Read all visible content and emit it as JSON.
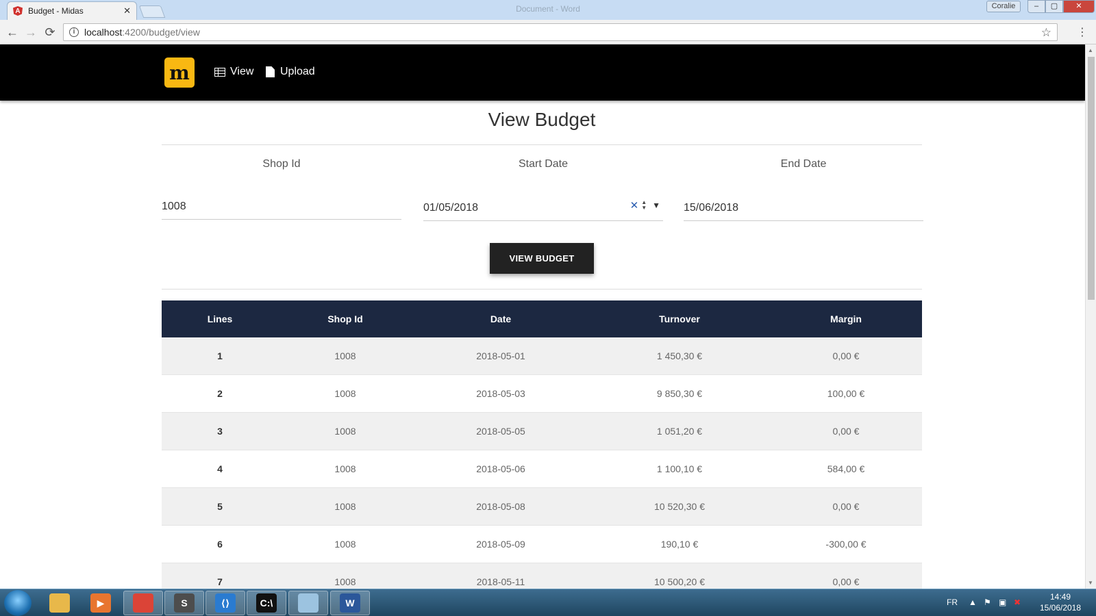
{
  "browser": {
    "tab_title": "Budget - Midas",
    "tab_close": "✕",
    "window_title": "Document - Word",
    "user_badge": "Coralie",
    "url_host": "localhost",
    "url_path": ":4200/budget/view",
    "controls": {
      "minimize": "–",
      "maximize": "▢",
      "close": "✕"
    },
    "icons": {
      "back": "←",
      "forward": "→",
      "reload": "⟳",
      "info": "i",
      "star": "☆",
      "menu": "⋮"
    }
  },
  "navbar": {
    "logo_text": "m",
    "links": [
      {
        "label": "View",
        "icon": "table-icon"
      },
      {
        "label": "Upload",
        "icon": "file-icon"
      }
    ]
  },
  "page": {
    "title": "View Budget",
    "fields": {
      "shop_id": {
        "label": "Shop Id",
        "value": "1008"
      },
      "start_date": {
        "label": "Start Date",
        "value": "01/05/2018"
      },
      "end_date": {
        "label": "End Date",
        "value": "15/06/2018"
      }
    },
    "date_controls": {
      "clear": "✕",
      "up": "▲",
      "down": "▼",
      "dropdown": "▼"
    },
    "view_button": "VIEW BUDGET"
  },
  "table": {
    "headers": [
      "Lines",
      "Shop Id",
      "Date",
      "Turnover",
      "Margin"
    ],
    "rows": [
      [
        "1",
        "1008",
        "2018-05-01",
        "1 450,30 €",
        "0,00 €"
      ],
      [
        "2",
        "1008",
        "2018-05-03",
        "9 850,30 €",
        "100,00 €"
      ],
      [
        "3",
        "1008",
        "2018-05-05",
        "1 051,20 €",
        "0,00 €"
      ],
      [
        "4",
        "1008",
        "2018-05-06",
        "1 100,10 €",
        "584,00 €"
      ],
      [
        "5",
        "1008",
        "2018-05-08",
        "10 520,30 €",
        "0,00 €"
      ],
      [
        "6",
        "1008",
        "2018-05-09",
        "190,10 €",
        "-300,00 €"
      ],
      [
        "7",
        "1008",
        "2018-05-11",
        "10 500,20 €",
        "0,00 €"
      ]
    ]
  },
  "taskbar": {
    "apps": [
      {
        "name": "explorer",
        "glyph": "",
        "color": "#e8b84a"
      },
      {
        "name": "media-player",
        "glyph": "▶",
        "color": "#e8752f"
      },
      {
        "name": "chrome",
        "glyph": "",
        "color": "#db4437"
      },
      {
        "name": "sublime",
        "glyph": "S",
        "color": "#4d4d4d"
      },
      {
        "name": "vscode",
        "glyph": "⟨⟩",
        "color": "#2a7bd0"
      },
      {
        "name": "cmd",
        "glyph": "C:\\",
        "color": "#111111"
      },
      {
        "name": "notepad",
        "glyph": "",
        "color": "#9cc3e0"
      },
      {
        "name": "word",
        "glyph": "W",
        "color": "#2b579a"
      }
    ],
    "language": "FR",
    "time": "14:49",
    "date": "15/06/2018"
  },
  "colors": {
    "table_header": "#1c2841",
    "logo_bg": "#f9b812",
    "navbar_bg": "#000000",
    "button_bg": "#222222"
  }
}
